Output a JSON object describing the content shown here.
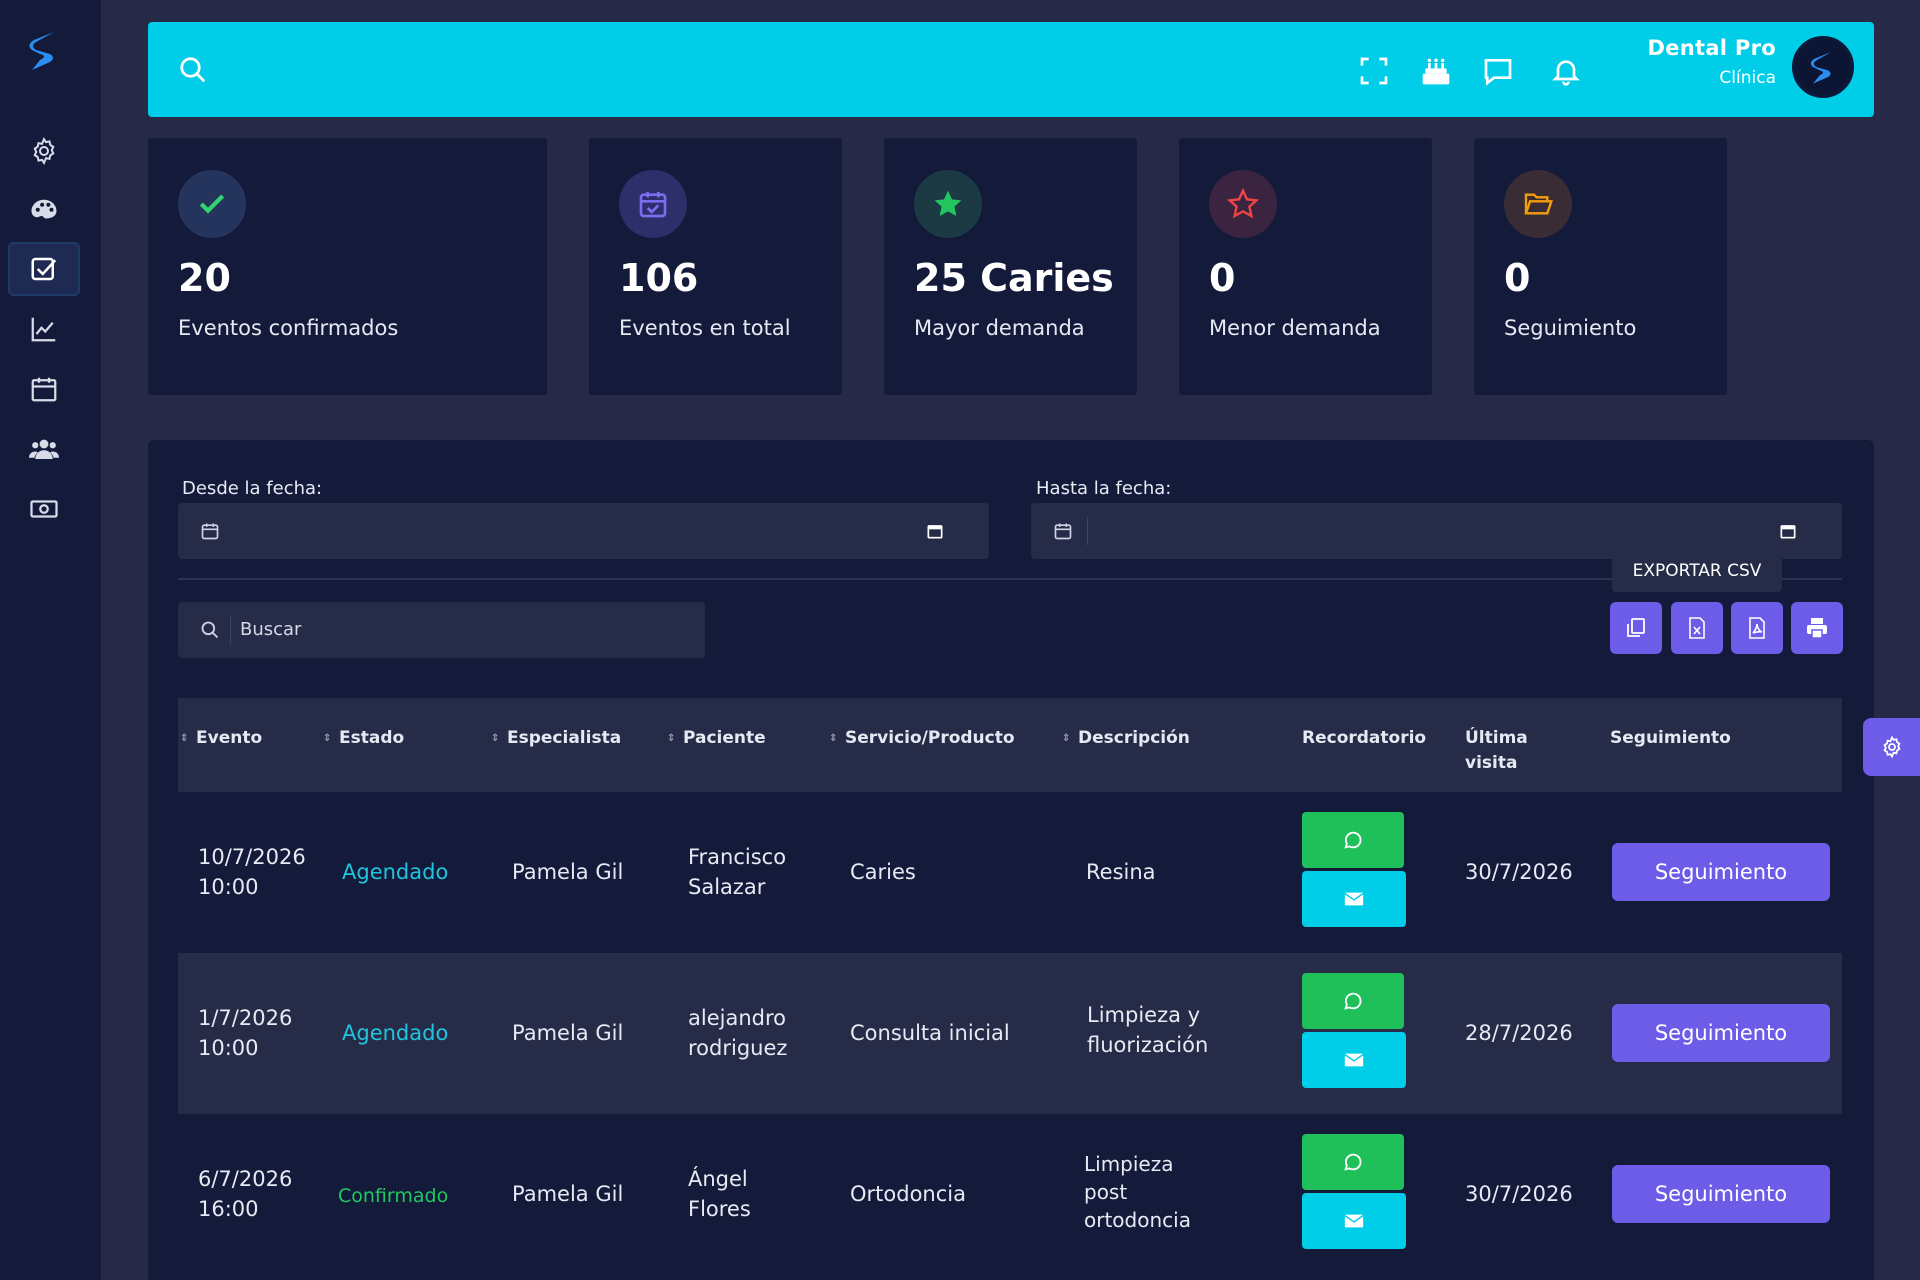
{
  "header": {
    "brand_name": "Dental Pro",
    "brand_sub": "Clínica"
  },
  "sidebar": {
    "items": [
      {
        "icon": "gear-icon"
      },
      {
        "icon": "palette-icon"
      },
      {
        "icon": "check-square-icon",
        "active": true
      },
      {
        "icon": "chart-line-icon"
      },
      {
        "icon": "calendar-icon"
      },
      {
        "icon": "users-icon"
      },
      {
        "icon": "money-icon"
      }
    ]
  },
  "stats": [
    {
      "value": "20",
      "label": "Eventos confirmados",
      "icon": "check-icon",
      "icon_bg": "#25345c",
      "icon_color": "#2fd46e"
    },
    {
      "value": "106",
      "label": "Eventos en total",
      "icon": "calendar-check-icon",
      "icon_bg": "#2c2f6a",
      "icon_color": "#7b6cf0"
    },
    {
      "value": "25 Caries",
      "label": "Mayor demanda",
      "icon": "star-filled-icon",
      "icon_bg": "#1c3a44",
      "icon_color": "#22c55e"
    },
    {
      "value": "0",
      "label": "Menor demanda",
      "icon": "star-outline-icon",
      "icon_bg": "#3a2440",
      "icon_color": "#ef4444"
    },
    {
      "value": "0",
      "label": "Seguimiento",
      "icon": "folder-open-icon",
      "icon_bg": "#3a2c35",
      "icon_color": "#f59e0b"
    }
  ],
  "filters": {
    "from_label": "Desde la fecha:",
    "to_label": "Hasta la fecha:",
    "search_placeholder": "Buscar"
  },
  "toolbar": {
    "tooltip": "EXPORTAR CSV",
    "buttons": [
      "copy-icon",
      "file-csv-icon",
      "file-pdf-icon",
      "print-icon"
    ]
  },
  "table": {
    "columns": [
      "Evento",
      "Estado",
      "Especialista",
      "Paciente",
      "Servicio/Producto",
      "Descripción",
      "Recordatorio",
      "Última visita",
      "Seguimiento"
    ],
    "rows": [
      {
        "evento": [
          "10/7/2026",
          "10:00"
        ],
        "estado": "Agendado",
        "especialista": "Pamela Gil",
        "paciente": [
          "Francisco",
          "Salazar"
        ],
        "servicio": "Caries",
        "descripcion": [
          "Resina"
        ],
        "ultima": "30/7/2026",
        "seguimiento": "Seguimiento"
      },
      {
        "evento": [
          "1/7/2026",
          "10:00"
        ],
        "estado": "Agendado",
        "especialista": "Pamela Gil",
        "paciente": [
          "alejandro",
          "rodriguez"
        ],
        "servicio": "Consulta inicial",
        "descripcion": [
          "Limpieza y",
          "fluorización"
        ],
        "ultima": "28/7/2026",
        "seguimiento": "Seguimiento"
      },
      {
        "evento": [
          "6/7/2026",
          "16:00"
        ],
        "estado": "Confirmado",
        "especialista": "Pamela Gil",
        "paciente": [
          "Ángel",
          "Flores"
        ],
        "servicio": "Ortodoncia",
        "descripcion": [
          "Limpieza",
          "post",
          "ortodoncia"
        ],
        "ultima": "30/7/2026",
        "seguimiento": "Seguimiento"
      }
    ]
  },
  "colors": {
    "accent": "#00cde7",
    "primary": "#6c5ce7",
    "whatsapp": "#1fbf5a",
    "background": "#262a47",
    "card": "#141a3a"
  }
}
